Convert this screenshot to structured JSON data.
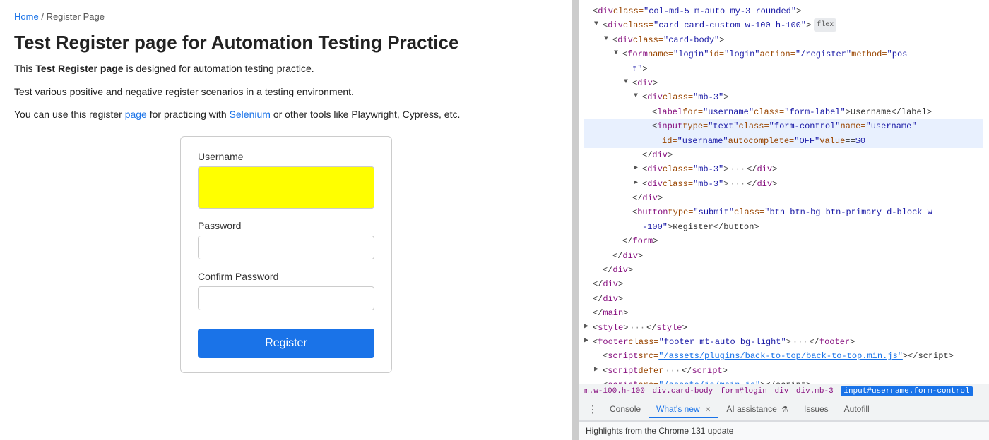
{
  "breadcrumb": {
    "home_label": "Home",
    "separator": "/",
    "current": "Register Page"
  },
  "page": {
    "title": "Test Register page for Automation Testing Practice",
    "description_part1": "This ",
    "description_bold": "Test Register page",
    "description_part2": " is designed for automation testing practice.",
    "description_line2": "Test various positive and negative register scenarios in a testing environment.",
    "description_line3_before": "You can use this register ",
    "description_line3_link1_text": "page",
    "description_line3_middle": " for practicing with ",
    "description_line3_link2_text": "Selenium",
    "description_line3_after": " or other tools like Playwright, Cypress, etc."
  },
  "form": {
    "username_label": "Username",
    "password_label": "Password",
    "confirm_password_label": "Confirm Password",
    "register_button": "Register"
  },
  "devtools": {
    "tabs": [
      "Console",
      "What's new",
      "AI assistance",
      "Issues",
      "Autofill"
    ],
    "active_tab": "What's new",
    "close_tabs": [
      "What's new"
    ],
    "bottom_message": "Highlights from the Chrome 131 update",
    "breadcrumb": "m.w-100.h-100   div.card-body   form#login   div   div.mb-3   input#username.form-control",
    "highlighted_line": "username"
  }
}
